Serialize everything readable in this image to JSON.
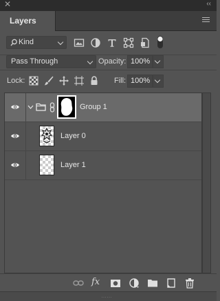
{
  "panel": {
    "close_glyph": "✕",
    "collapse_glyph": "‹‹",
    "tab_label": "Layers",
    "menu_icon": "panel-menu-icon"
  },
  "filter": {
    "kind_label": "Kind",
    "filter_icons": [
      "pixel-filter-icon",
      "adjustment-filter-icon",
      "type-filter-icon",
      "shape-filter-icon",
      "smart-object-filter-icon",
      "filter-toggle-icon"
    ]
  },
  "blend": {
    "mode": "Pass Through",
    "opacity_label": "Opacity:",
    "opacity_value": "100%"
  },
  "lock": {
    "label": "Lock:",
    "fill_label": "Fill:",
    "fill_value": "100%",
    "lock_icons": [
      "lock-transparent-pixels-icon",
      "lock-image-pixels-icon",
      "lock-position-icon",
      "lock-artboard-icon",
      "lock-all-icon"
    ]
  },
  "layers": [
    {
      "name": "Group 1",
      "type": "group",
      "selected": true
    },
    {
      "name": "Layer 0",
      "type": "pixel",
      "selected": false
    },
    {
      "name": "Layer 1",
      "type": "pixel",
      "selected": false
    }
  ],
  "bottom_bar": {
    "fx_label": "fx",
    "icons": [
      "link-layers-icon",
      "fx-icon",
      "add-mask-icon",
      "new-adjustment-icon",
      "new-group-icon",
      "new-layer-icon",
      "delete-layer-icon"
    ]
  },
  "colors": {
    "panel_bg": "#535353",
    "selected_row": "#6a6a6a"
  }
}
